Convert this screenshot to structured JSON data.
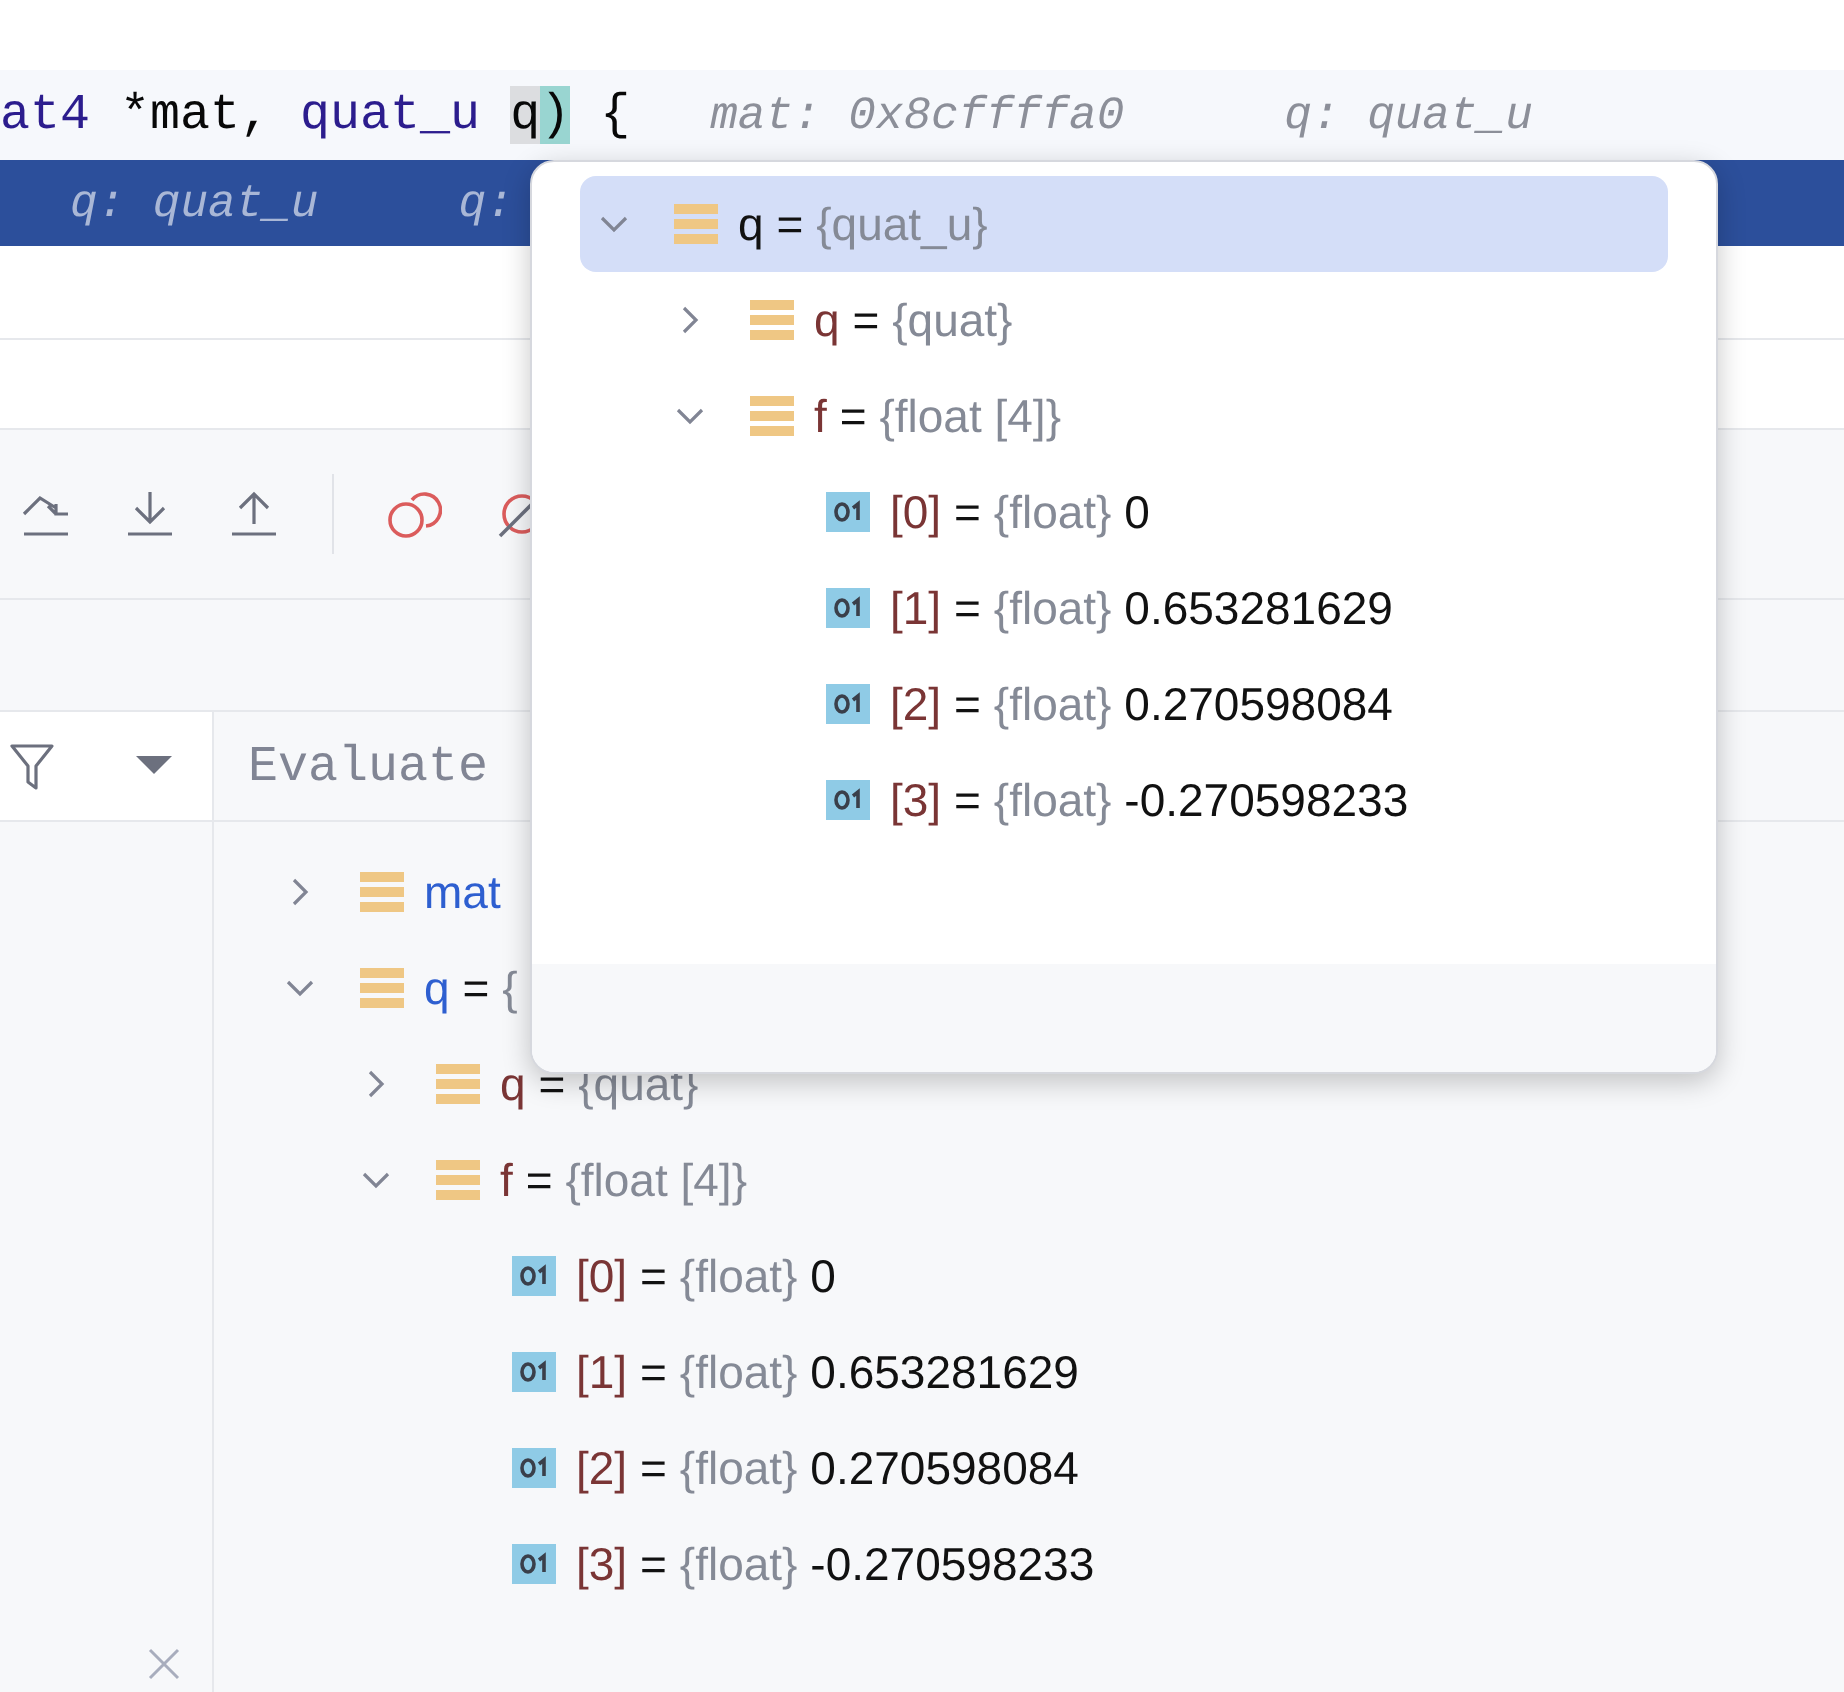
{
  "editor": {
    "code_tokens": [
      {
        "text": "at4",
        "kind": "type"
      },
      {
        "text": " *mat, ",
        "kind": "plain"
      },
      {
        "text": "quat_u",
        "kind": "type"
      },
      {
        "text": "q",
        "kind": "caret_word"
      },
      {
        "text": ")",
        "kind": "brace_match"
      },
      {
        "text": " {",
        "kind": "plain"
      }
    ],
    "inline_hints": [
      "mat: 0x8cffffa0",
      "q: quat_u"
    ],
    "current_line_hints": [
      "q: quat_u",
      "q:"
    ]
  },
  "variables_panel": {
    "evaluate_label": "Evaluate",
    "tree": [
      {
        "name": "mat",
        "kind": "local_struct",
        "expanded": false
      },
      {
        "name": "q",
        "eq": "=",
        "type": "{",
        "kind": "local_struct",
        "expanded": true,
        "children": [
          {
            "name": "q",
            "eq": "=",
            "type": "{quat}",
            "kind": "field_struct",
            "expanded": false
          },
          {
            "name": "f",
            "eq": "=",
            "type": "{float [4]}",
            "kind": "field_struct",
            "expanded": true,
            "children": [
              {
                "name": "[0]",
                "eq": "=",
                "type": "{float}",
                "value": "0",
                "kind": "field_primitive"
              },
              {
                "name": "[1]",
                "eq": "=",
                "type": "{float}",
                "value": "0.653281629",
                "kind": "field_primitive"
              },
              {
                "name": "[2]",
                "eq": "=",
                "type": "{float}",
                "value": "0.270598084",
                "kind": "field_primitive"
              },
              {
                "name": "[3]",
                "eq": "=",
                "type": "{float}",
                "value": "-0.270598233",
                "kind": "field_primitive"
              }
            ]
          }
        ]
      }
    ]
  },
  "popup": {
    "tree": [
      {
        "name": "q",
        "eq": "=",
        "type": "{quat_u}",
        "kind": "root_struct",
        "expanded": true,
        "selected": true,
        "children": [
          {
            "name": "q",
            "eq": "=",
            "type": "{quat}",
            "kind": "field_struct",
            "expanded": false,
            "selected": false
          },
          {
            "name": "f",
            "eq": "=",
            "type": "{float [4]}",
            "kind": "field_struct",
            "expanded": true,
            "selected": false,
            "children": [
              {
                "name": "[0]",
                "eq": "=",
                "type": "{float}",
                "value": "0",
                "kind": "field_primitive",
                "selected": false
              },
              {
                "name": "[1]",
                "eq": "=",
                "type": "{float}",
                "value": "0.653281629",
                "kind": "field_primitive",
                "selected": false
              },
              {
                "name": "[2]",
                "eq": "=",
                "type": "{float}",
                "value": "0.270598084",
                "kind": "field_primitive",
                "selected": false
              },
              {
                "name": "[3]",
                "eq": "=",
                "type": "{float}",
                "value": "-0.270598233",
                "kind": "field_primitive",
                "selected": false
              }
            ]
          }
        ]
      }
    ]
  }
}
